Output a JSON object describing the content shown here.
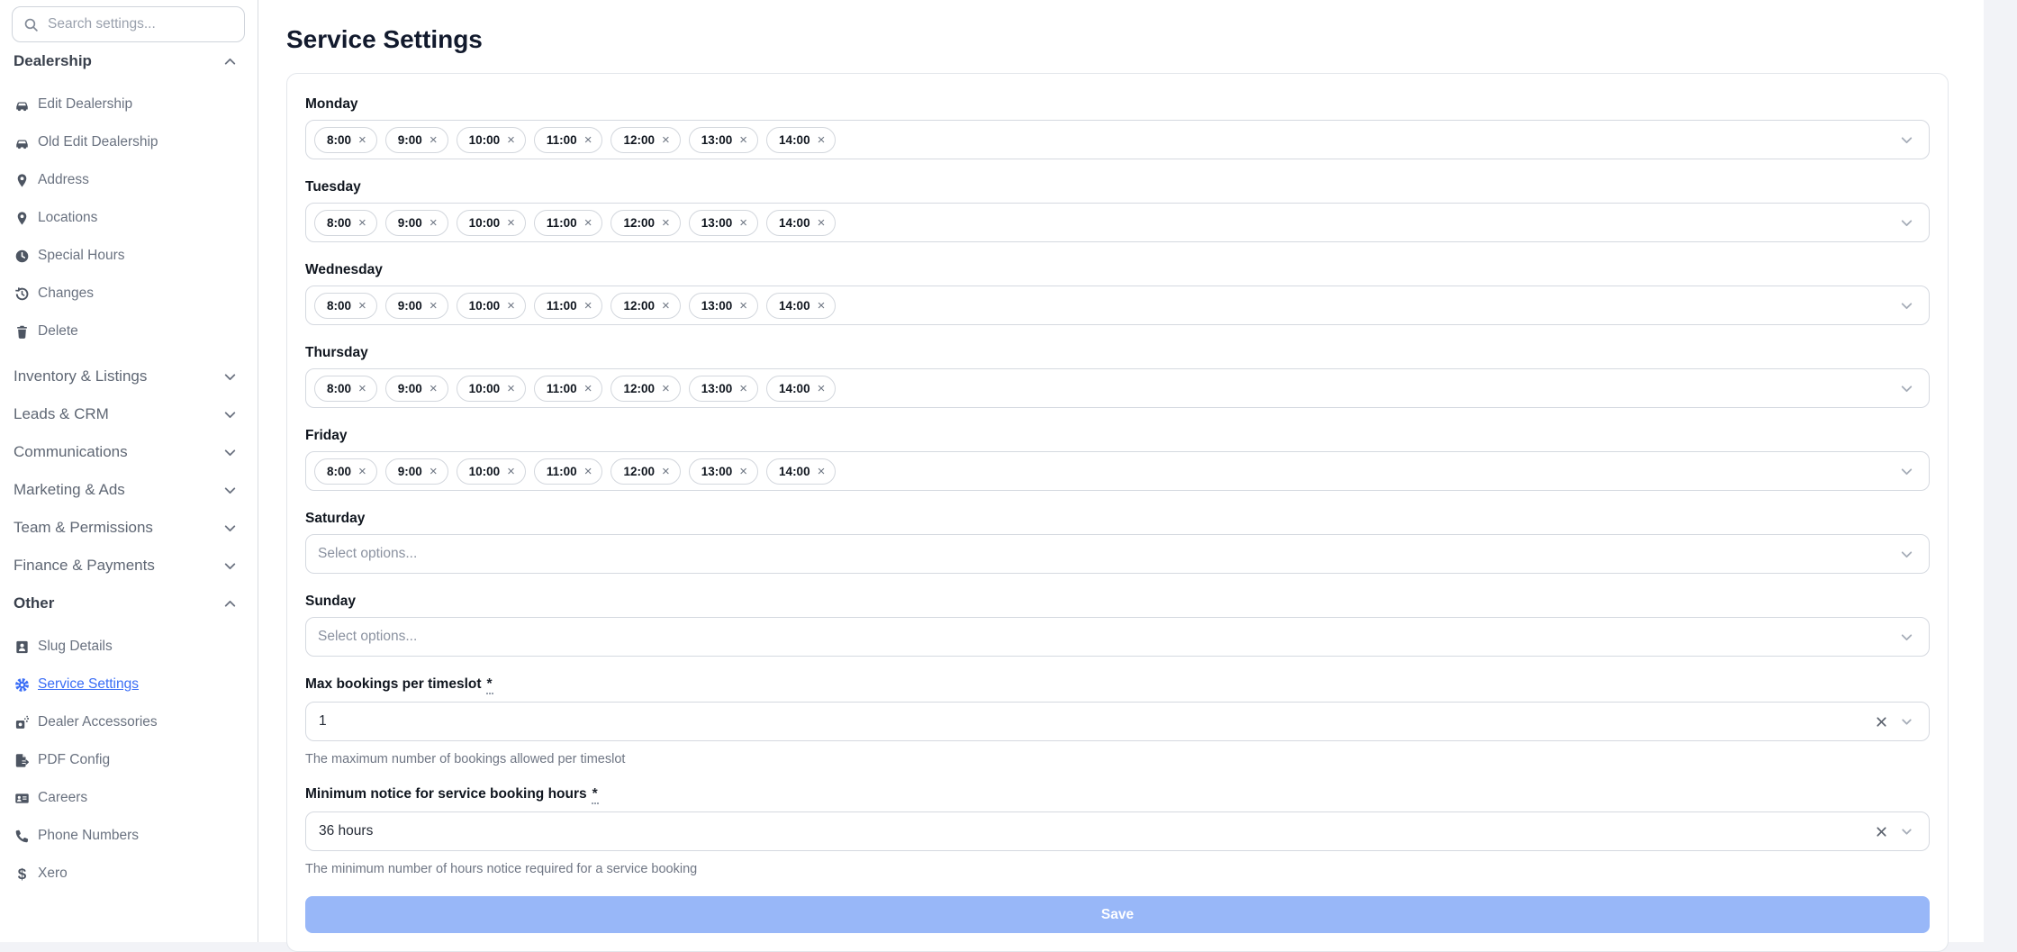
{
  "sidebar": {
    "search_placeholder": "Search settings...",
    "sections": [
      {
        "label": "Dealership",
        "state": "expanded",
        "items": [
          {
            "icon": "car-icon",
            "label": "Edit Dealership"
          },
          {
            "icon": "car-icon",
            "label": "Old Edit Dealership"
          },
          {
            "icon": "location-pin-icon",
            "label": "Address"
          },
          {
            "icon": "location-pin-icon",
            "label": "Locations"
          },
          {
            "icon": "clock-icon",
            "label": "Special Hours"
          },
          {
            "icon": "history-icon",
            "label": "Changes"
          },
          {
            "icon": "trash-icon",
            "label": "Delete"
          }
        ]
      },
      {
        "label": "Inventory & Listings",
        "state": "collapsed"
      },
      {
        "label": "Leads & CRM",
        "state": "collapsed"
      },
      {
        "label": "Communications",
        "state": "collapsed"
      },
      {
        "label": "Marketing & Ads",
        "state": "collapsed"
      },
      {
        "label": "Team & Permissions",
        "state": "collapsed"
      },
      {
        "label": "Finance & Payments",
        "state": "collapsed"
      },
      {
        "label": "Other",
        "state": "expanded",
        "items": [
          {
            "icon": "contact-card-icon",
            "label": "Slug Details"
          },
          {
            "icon": "gear-icon",
            "label": "Service Settings",
            "active": true
          },
          {
            "icon": "car-accessories-icon",
            "label": "Dealer Accessories"
          },
          {
            "icon": "file-export-icon",
            "label": "PDF Config"
          },
          {
            "icon": "id-card-icon",
            "label": "Careers"
          },
          {
            "icon": "phone-icon",
            "label": "Phone Numbers"
          },
          {
            "icon": "dollar-icon",
            "label": "Xero"
          }
        ]
      }
    ]
  },
  "main": {
    "title": "Service Settings",
    "day_fields": [
      {
        "label": "Monday",
        "tags": [
          "8:00",
          "9:00",
          "10:00",
          "11:00",
          "12:00",
          "13:00",
          "14:00"
        ]
      },
      {
        "label": "Tuesday",
        "tags": [
          "8:00",
          "9:00",
          "10:00",
          "11:00",
          "12:00",
          "13:00",
          "14:00"
        ]
      },
      {
        "label": "Wednesday",
        "tags": [
          "8:00",
          "9:00",
          "10:00",
          "11:00",
          "12:00",
          "13:00",
          "14:00"
        ]
      },
      {
        "label": "Thursday",
        "tags": [
          "8:00",
          "9:00",
          "10:00",
          "11:00",
          "12:00",
          "13:00",
          "14:00"
        ]
      },
      {
        "label": "Friday",
        "tags": [
          "8:00",
          "9:00",
          "10:00",
          "11:00",
          "12:00",
          "13:00",
          "14:00"
        ]
      },
      {
        "label": "Saturday",
        "placeholder": "Select options..."
      },
      {
        "label": "Sunday",
        "placeholder": "Select options..."
      }
    ],
    "max_bookings": {
      "label": "Max bookings per timeslot",
      "required_mark": "*",
      "value": "1",
      "help": "The maximum number of bookings allowed per timeslot"
    },
    "min_notice": {
      "label": "Minimum notice for service booking hours",
      "required_mark": "*",
      "value": "36 hours",
      "help": "The minimum number of hours notice required for a service booking"
    },
    "save_label": "Save"
  },
  "colors": {
    "accent": "#3b6ef6",
    "save_button_bg": "#98b7f8",
    "save_button_text": "#ffffff"
  }
}
